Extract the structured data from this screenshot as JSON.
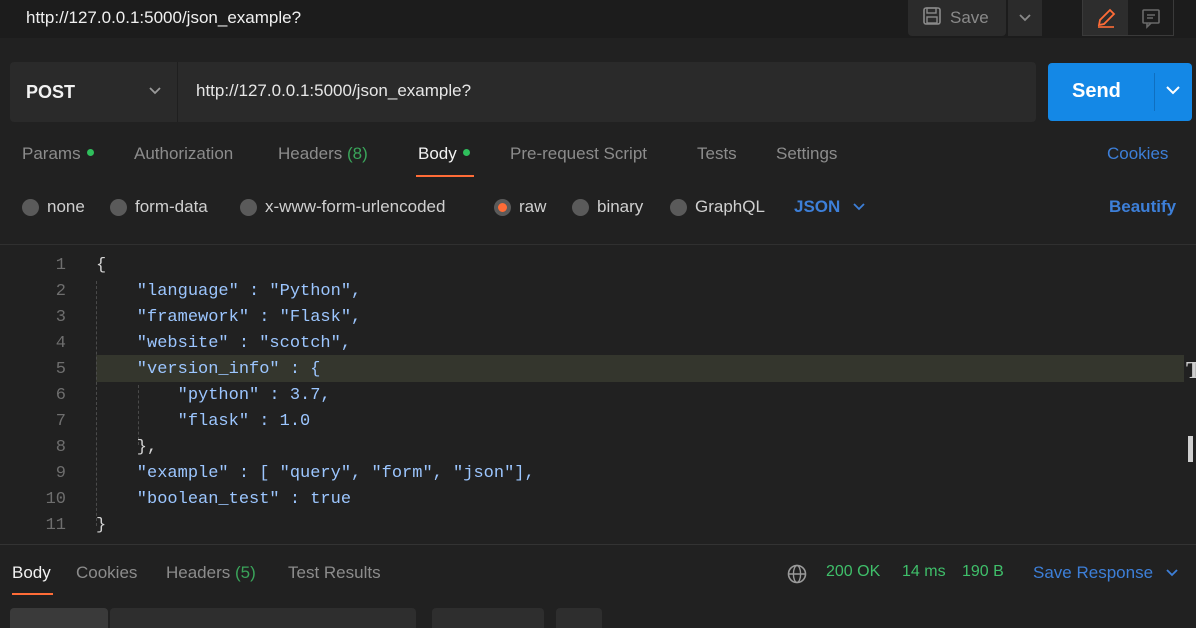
{
  "window": {
    "title": "http://127.0.0.1:5000/json_example?",
    "save_label": "Save"
  },
  "request": {
    "method": "POST",
    "url": "http://127.0.0.1:5000/json_example?",
    "send_label": "Send"
  },
  "tabs": [
    {
      "label": "Params",
      "dot": true
    },
    {
      "label": "Authorization"
    },
    {
      "label": "Headers",
      "count": "(8)"
    },
    {
      "label": "Body",
      "dot": true,
      "active": true
    },
    {
      "label": "Pre-request Script"
    },
    {
      "label": "Tests"
    },
    {
      "label": "Settings"
    }
  ],
  "cookies_label": "Cookies",
  "body_types": [
    {
      "label": "none"
    },
    {
      "label": "form-data"
    },
    {
      "label": "x-www-form-urlencoded"
    },
    {
      "label": "raw",
      "selected": true
    },
    {
      "label": "binary"
    },
    {
      "label": "GraphQL"
    }
  ],
  "body_format": "JSON",
  "beautify_label": "Beautify",
  "code_lines": [
    "{",
    "    \"language\" : \"Python\",",
    "    \"framework\" : \"Flask\",",
    "    \"website\" : \"scotch\",",
    "    \"version_info\" : {",
    "        \"python\" : 3.7,",
    "        \"flask\" : 1.0",
    "    },",
    "    \"example\" : [ \"query\", \"form\", \"json\"],",
    "    \"boolean_test\" : true",
    "}"
  ],
  "response": {
    "tabs": [
      {
        "label": "Body",
        "active": true
      },
      {
        "label": "Cookies"
      },
      {
        "label": "Headers",
        "count": "(5)"
      },
      {
        "label": "Test Results"
      }
    ],
    "status": "200 OK",
    "time": "14 ms",
    "size": "190 B",
    "save_label": "Save Response"
  },
  "colors": {
    "accent": "#ff6c37",
    "send": "#1488e6",
    "link": "#3d7fd8",
    "success": "#3fbf6a"
  },
  "icons": [
    "save-icon",
    "chevron-down-icon",
    "pencil-icon",
    "comment-icon",
    "globe-icon"
  ]
}
